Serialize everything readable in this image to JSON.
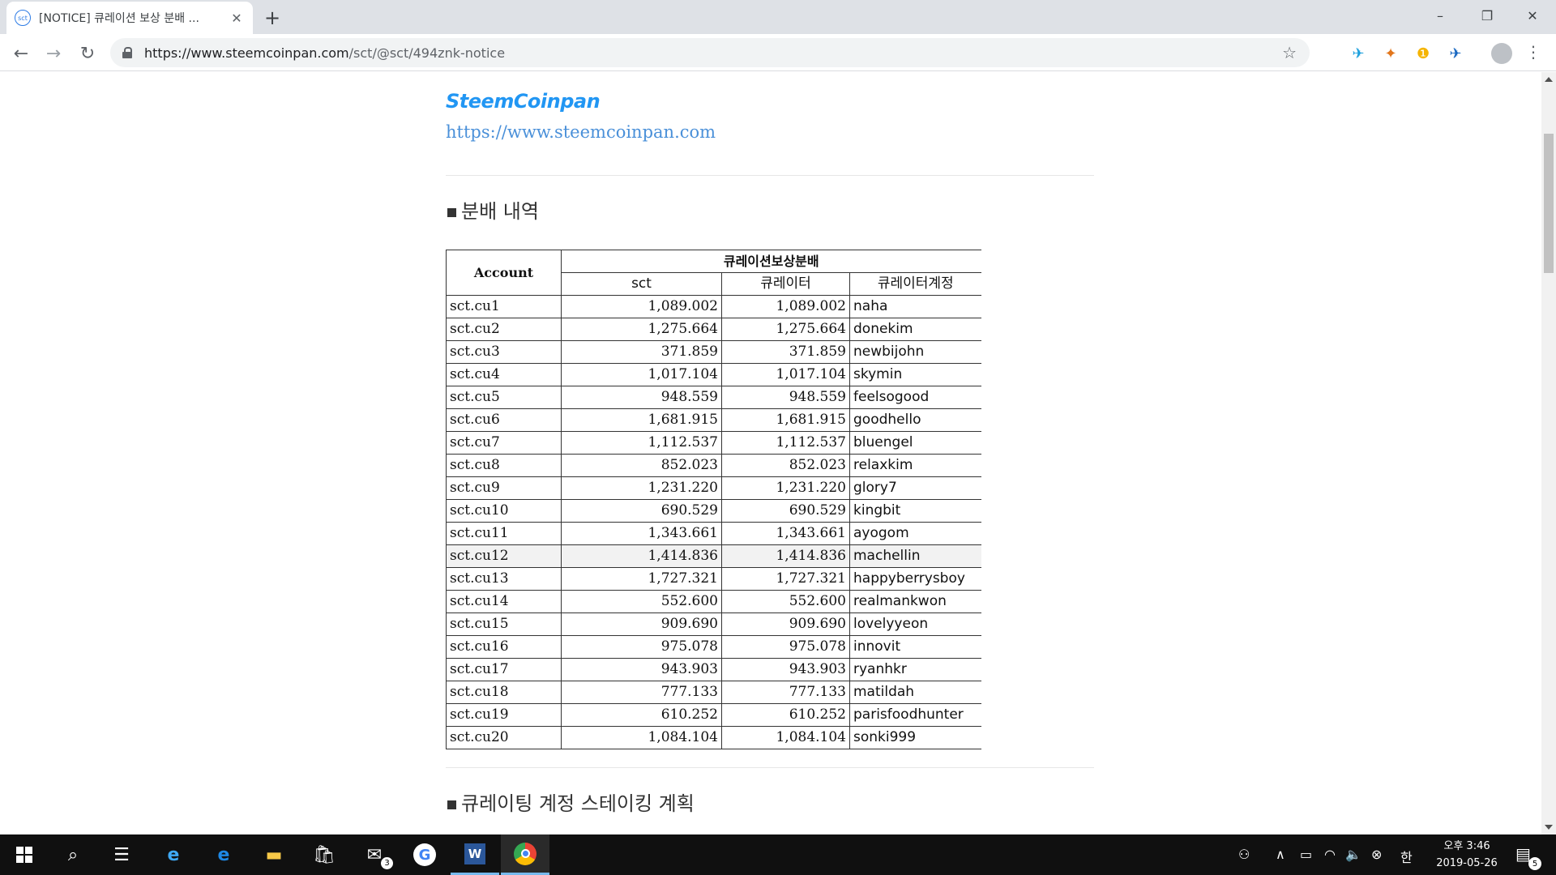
{
  "browser": {
    "tab_favicon": "sct",
    "tab_title": "[NOTICE] 큐레이션 보상 분배 ...",
    "url_host": "https://www.steemcoinpan.com",
    "url_path": "/sct/@sct/494znk-notice"
  },
  "page": {
    "logo": "SteemCoinpan",
    "site_link": "https://www.steemcoinpan.com",
    "section1_title": "분배 내역",
    "section2_title": "큐레이팅 계정 스테이킹 계획"
  },
  "table": {
    "account_header": "Account",
    "group_header": "큐레이션보상분배",
    "sub_headers": [
      "sct",
      "큐레이터",
      "큐레이터계정"
    ],
    "rows": [
      {
        "account": "sct.cu1",
        "sct": "1,089.002",
        "curator": "1,089.002",
        "name": "naha"
      },
      {
        "account": "sct.cu2",
        "sct": "1,275.664",
        "curator": "1,275.664",
        "name": "donekim"
      },
      {
        "account": "sct.cu3",
        "sct": "371.859",
        "curator": "371.859",
        "name": "newbijohn"
      },
      {
        "account": "sct.cu4",
        "sct": "1,017.104",
        "curator": "1,017.104",
        "name": "skymin"
      },
      {
        "account": "sct.cu5",
        "sct": "948.559",
        "curator": "948.559",
        "name": "feelsogood"
      },
      {
        "account": "sct.cu6",
        "sct": "1,681.915",
        "curator": "1,681.915",
        "name": "goodhello"
      },
      {
        "account": "sct.cu7",
        "sct": "1,112.537",
        "curator": "1,112.537",
        "name": "bluengel"
      },
      {
        "account": "sct.cu8",
        "sct": "852.023",
        "curator": "852.023",
        "name": "relaxkim"
      },
      {
        "account": "sct.cu9",
        "sct": "1,231.220",
        "curator": "1,231.220",
        "name": "glory7"
      },
      {
        "account": "sct.cu10",
        "sct": "690.529",
        "curator": "690.529",
        "name": "kingbit"
      },
      {
        "account": "sct.cu11",
        "sct": "1,343.661",
        "curator": "1,343.661",
        "name": "ayogom"
      },
      {
        "account": "sct.cu12",
        "sct": "1,414.836",
        "curator": "1,414.836",
        "name": "machellin"
      },
      {
        "account": "sct.cu13",
        "sct": "1,727.321",
        "curator": "1,727.321",
        "name": "happyberrysboy"
      },
      {
        "account": "sct.cu14",
        "sct": "552.600",
        "curator": "552.600",
        "name": "realmankwon"
      },
      {
        "account": "sct.cu15",
        "sct": "909.690",
        "curator": "909.690",
        "name": "lovelyyeon"
      },
      {
        "account": "sct.cu16",
        "sct": "975.078",
        "curator": "975.078",
        "name": "innovit"
      },
      {
        "account": "sct.cu17",
        "sct": "943.903",
        "curator": "943.903",
        "name": "ryanhkr"
      },
      {
        "account": "sct.cu18",
        "sct": "777.133",
        "curator": "777.133",
        "name": "matildah"
      },
      {
        "account": "sct.cu19",
        "sct": "610.252",
        "curator": "610.252",
        "name": "parisfoodhunter"
      },
      {
        "account": "sct.cu20",
        "sct": "1,084.104",
        "curator": "1,084.104",
        "name": "sonki999"
      }
    ]
  },
  "taskbar": {
    "mail_badge": "3",
    "ime": "한",
    "time": "오후 3:46",
    "date": "2019-05-26",
    "notif_count": "5"
  }
}
